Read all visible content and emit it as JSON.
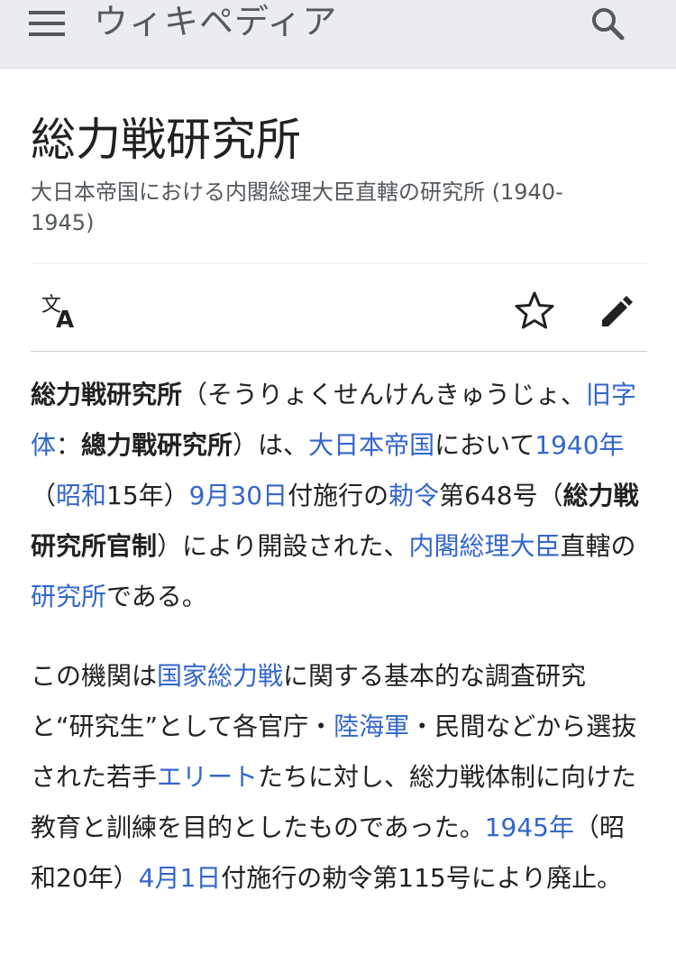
{
  "header": {
    "wordmark": "ウィキペディア",
    "menu_icon": "hamburger-menu-icon",
    "search_icon": "search-icon"
  },
  "page": {
    "title": "総力戦研究所",
    "description": "大日本帝国における内閣総理大臣直轄の研究所 (1940-1945)"
  },
  "actions": {
    "language_icon": "language-icon",
    "watch_icon": "star-icon",
    "edit_icon": "pencil-icon"
  },
  "paragraph1": {
    "bold_title": "総力戦研究所",
    "t1": "（そうりょくせんけんきゅうじょ、",
    "link_kyujitai": "旧字体",
    "t2": "：",
    "bold_kyujitai": "總力戰硏究所",
    "t3": "）は、",
    "link_empire": "大日本帝国",
    "t4": "において",
    "link_1940": "1940年",
    "t5": "（",
    "link_showa": "昭和",
    "t6": "15年）",
    "link_sep30": "9月30日",
    "t7": "付施行の",
    "link_chokurei": "勅令",
    "t8": "第648号（",
    "bold_kansei": "総力戦研究所官制",
    "t9": "）により開設された、",
    "link_pm": "内閣総理大臣",
    "t10": "直轄の",
    "link_institute": "研究所",
    "t11": "である。"
  },
  "paragraph2": {
    "t1": "この機関は",
    "link_total_war": "国家総力戦",
    "t2": "に関する基本的な調査研究と“研究生”として各官庁・",
    "link_army": "陸海軍",
    "t3": "・民間などから選抜された若手",
    "link_elite": "エリート",
    "t4": "たちに対し、総力戦体制に向けた教育と訓練を目的としたものであった。",
    "link_1945": "1945年",
    "t5": "（昭和20年）",
    "link_apr1": "4月1日",
    "t6": "付施行の勅令第115号により廃止。"
  },
  "colors": {
    "header_bg": "#eaecf0",
    "link": "#3366cc",
    "text": "#202122",
    "muted": "#54595d"
  }
}
